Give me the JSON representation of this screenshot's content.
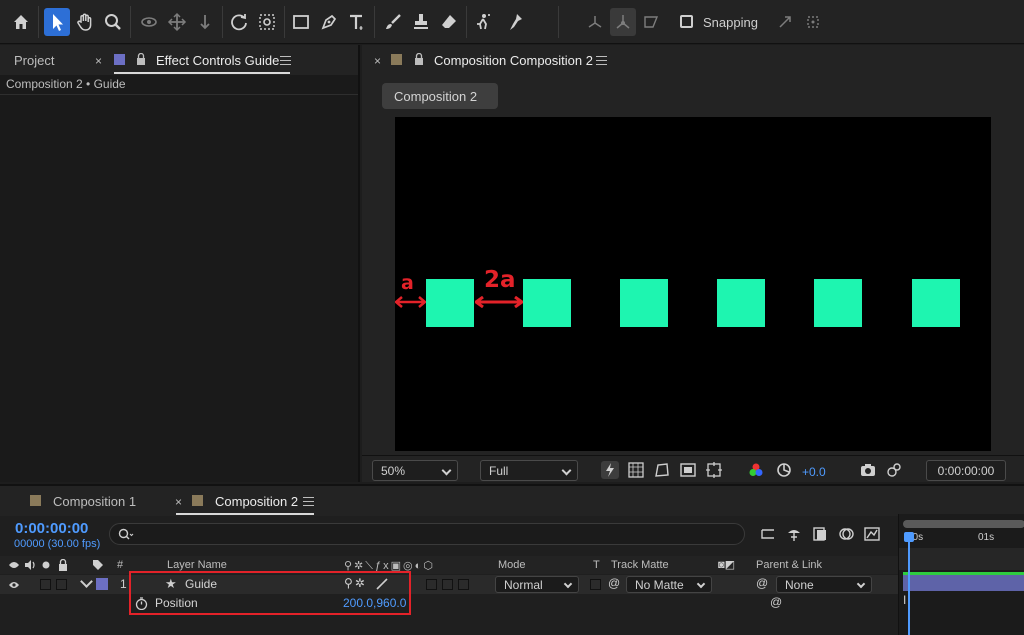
{
  "toolbar": {
    "tools": [
      "home-icon",
      "selection-tool-icon",
      "hand-tool-icon",
      "zoom-tool-icon",
      "orbit-camera-icon",
      "pan-camera-icon",
      "dolly-camera-icon",
      "rotation-tool-icon",
      "pan-behind-icon",
      "rectangle-tool-icon",
      "pen-tool-icon",
      "type-tool-icon",
      "brush-tool-icon",
      "clone-stamp-icon",
      "eraser-tool-icon",
      "roto-brush-icon",
      "puppet-tool-icon"
    ],
    "snapping_label": "Snapping"
  },
  "left_panel": {
    "tab_project": "Project",
    "tab_effect_controls": "Effect Controls Guide",
    "breadcrumb": "Composition 2 • Guide",
    "label_color": "#6c6fc4"
  },
  "comp_panel": {
    "tab_title": "Composition Composition 2",
    "comp_button": "Composition 2",
    "label_color": "#8a7a5a",
    "annotation_a": "a",
    "annotation_2a": "2a",
    "square_color": "#1ef5b0",
    "square_count": 6,
    "zoom": "50%",
    "resolution": "Full",
    "exposure": "+0.0",
    "timecode": "0:00:00:00"
  },
  "timeline": {
    "tab_comp1": "Composition 1",
    "tab_comp2": "Composition 2",
    "current_time": "0:00:00:00",
    "frame_info": "00000 (30.00 fps)",
    "headers": {
      "number": "#",
      "layer_name": "Layer Name",
      "mode": "Mode",
      "track_t": "T",
      "track_matte": "Track Matte",
      "parent_link": "Parent & Link"
    },
    "layer": {
      "index": "1",
      "name": "Guide",
      "mode": "Normal",
      "track_matte": "No Matte",
      "parent": "None",
      "label_color": "#6c6fc4"
    },
    "property": {
      "name": "Position",
      "value": "200.0,960.0"
    },
    "ruler": {
      "start": "00s",
      "mark": "01s"
    }
  }
}
